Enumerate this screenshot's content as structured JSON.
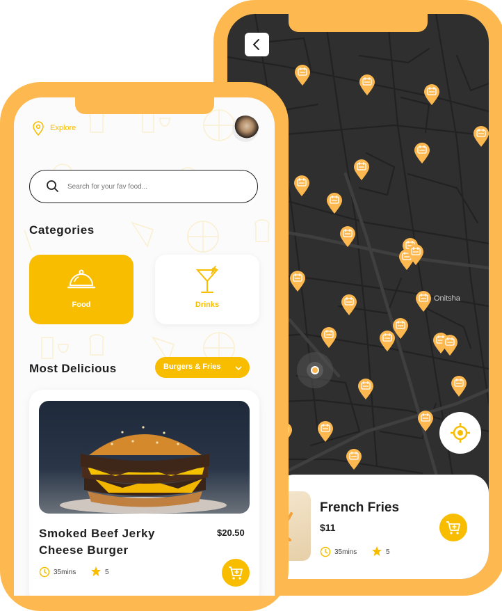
{
  "colors": {
    "accent": "#fdb94f",
    "primary": "#f9bd00",
    "map_bg": "#2f2f2f",
    "text": "#1e1e1e"
  },
  "explore": {
    "label": "Explore",
    "icon": "location-pin-icon"
  },
  "search": {
    "placeholder": "Search for your fav food..."
  },
  "categories": {
    "title": "Categories",
    "items": [
      {
        "label": "Food",
        "icon": "cloche-icon"
      },
      {
        "label": "Drinks",
        "icon": "cocktail-icon"
      }
    ]
  },
  "most_delicious": {
    "title": "Most Delicious",
    "filter": "Burgers & Fries"
  },
  "featured": {
    "name_line1": "Smoked Beef Jerky",
    "name_line2": "Cheese Burger",
    "price": "$20.50",
    "time": "35mins",
    "rating": "5"
  },
  "map": {
    "city_label": "Onitsha",
    "back_icon": "chevron-left-icon",
    "locate_icon": "crosshair-icon"
  },
  "map_card": {
    "name": "French Fries",
    "price": "$11",
    "time": "35mins",
    "rating": "5"
  }
}
